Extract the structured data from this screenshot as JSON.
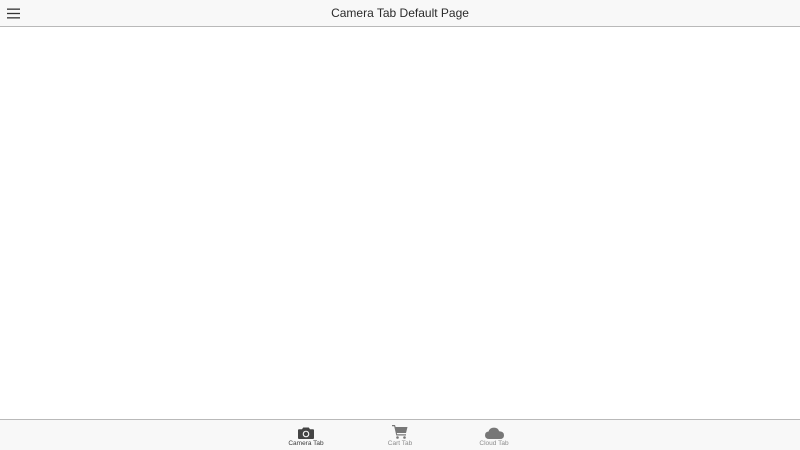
{
  "header": {
    "title": "Camera Tab Default Page",
    "menu_icon": "hamburger-menu-icon"
  },
  "tabs": [
    {
      "label": "Camera Tab",
      "icon": "camera-icon",
      "active": true
    },
    {
      "label": "Cart Tab",
      "icon": "cart-icon",
      "active": false
    },
    {
      "label": "Cloud Tab",
      "icon": "cloud-icon",
      "active": false
    }
  ],
  "colors": {
    "bar_background": "#f8f8f8",
    "border": "#b9b9b9",
    "active_icon": "#444444",
    "inactive_icon": "#777777",
    "title_text": "#2b2b2b"
  }
}
